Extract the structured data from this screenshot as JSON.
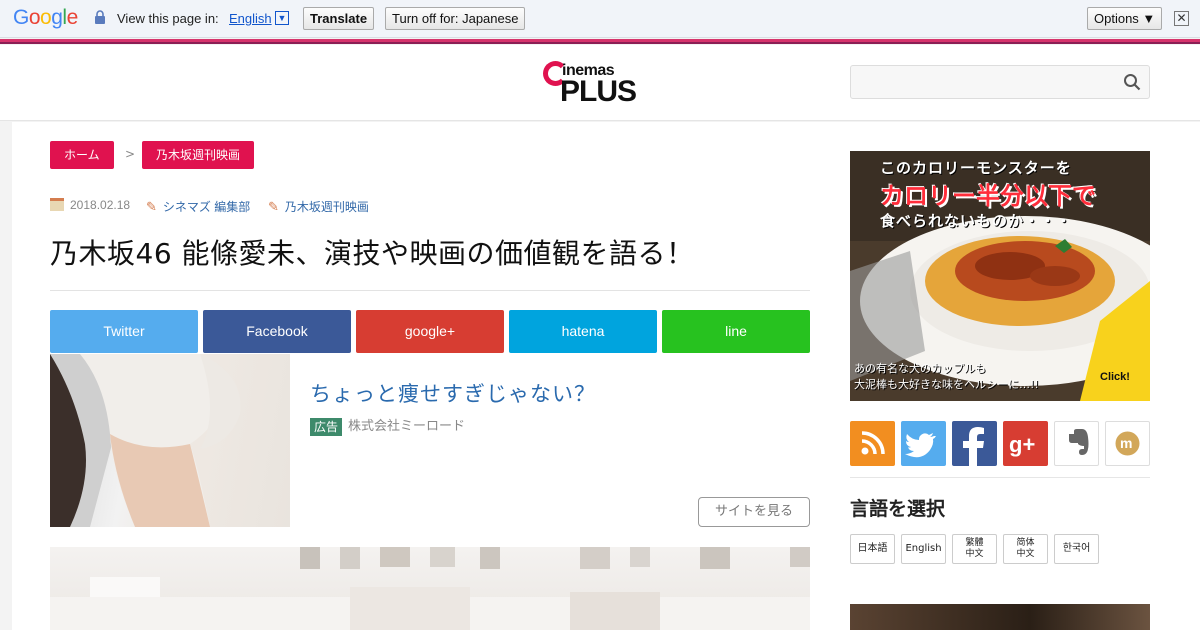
{
  "translate_bar": {
    "logo": "Google",
    "prompt": "View this page in:",
    "language": "English",
    "translate_label": "Translate",
    "turn_off_label": "Turn off for: Japanese",
    "options_label": "Options ▼",
    "close_glyph": "✕"
  },
  "header": {
    "logo_small": "inemas",
    "logo_big": "PLUS",
    "search_placeholder": ""
  },
  "breadcrumb": {
    "home": "ホーム",
    "separator": ">",
    "category": "乃木坂週刊映画"
  },
  "article": {
    "date": "2018.02.18",
    "author": "シネマズ 編集部",
    "category": "乃木坂週刊映画",
    "title": "乃木坂46 能條愛未、演技や映画の価値観を語る！"
  },
  "share_buttons": {
    "twitter": "Twitter",
    "facebook": "Facebook",
    "google": "google+",
    "hatena": "hatena",
    "line": "line"
  },
  "sponsored": {
    "headline": "ちょっと痩せすぎじゃない？",
    "badge": "広告",
    "sponsor": "株式会社ミーロード",
    "cta": "サイトを見る"
  },
  "sidebar_ad": {
    "line1": "このカロリーモンスターを",
    "line2": "カロリー半分以下で",
    "line3": "食べられないものか・・・",
    "bottom1": "あの有名な犬のカップルも",
    "bottom2": "大泥棒も大好きな味をヘルシーに…!!",
    "click": "Click!"
  },
  "language_select": {
    "title": "言語を選択",
    "options": [
      "日本語",
      "English",
      "繁體中文",
      "简体中文",
      "한국어"
    ],
    "option_lines": [
      [
        "繁體",
        "中文"
      ],
      [
        "简体",
        "中文"
      ]
    ]
  },
  "colors": {
    "accent": "#e0124f",
    "twitter": "#55acee",
    "facebook": "#3b5998",
    "google": "#d73d32",
    "hatena": "#00a4de",
    "line": "#27c21f",
    "rss": "#f28e20"
  },
  "icons": [
    "lock-icon",
    "search-icon",
    "calendar-icon",
    "pencil-icon",
    "rss-icon",
    "twitter-icon",
    "facebook-icon",
    "google-plus-icon",
    "evernote-icon",
    "mixi-icon"
  ]
}
